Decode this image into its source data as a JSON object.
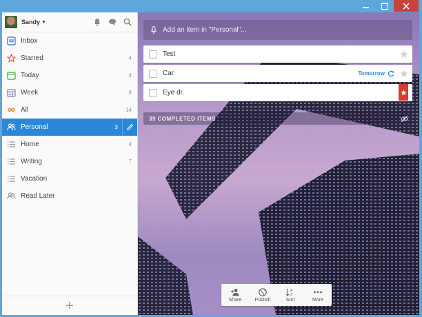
{
  "user": {
    "name": "Sandy"
  },
  "sidebar": {
    "items": [
      {
        "label": "Inbox",
        "count": "",
        "icon": "inbox-icon",
        "color": "#3a86d4"
      },
      {
        "label": "Starred",
        "count": "4",
        "icon": "star-icon",
        "color": "#e0473d"
      },
      {
        "label": "Today",
        "count": "4",
        "icon": "calendar-today-icon",
        "color": "#58b346"
      },
      {
        "label": "Week",
        "count": "8",
        "icon": "calendar-week-icon",
        "color": "#8a7fc6"
      },
      {
        "label": "All",
        "count": "14",
        "icon": "infinity-icon",
        "color": "#e78b3c"
      },
      {
        "label": "Personal",
        "count": "3",
        "icon": "people-icon",
        "color": "#ffffff"
      },
      {
        "label": "Home",
        "count": "4",
        "icon": "list-icon",
        "color": "#9a9a9a"
      },
      {
        "label": "Writing",
        "count": "7",
        "icon": "list-icon",
        "color": "#9a9a9a"
      },
      {
        "label": "Vacation",
        "count": "",
        "icon": "list-icon",
        "color": "#9a9a9a"
      },
      {
        "label": "Read Later",
        "count": "",
        "icon": "people-icon",
        "color": "#9a9a9a"
      }
    ],
    "add_label": "+"
  },
  "main": {
    "add_placeholder": "Add an item in \"Personal\"...",
    "tasks": [
      {
        "title": "Test",
        "due": "",
        "starred": false
      },
      {
        "title": "Car",
        "due": "Tomorrow",
        "starred": false
      },
      {
        "title": "Eye dr.",
        "due": "",
        "starred": true
      }
    ],
    "completed_label": "39 COMPLETED ITEMS",
    "toolbar": {
      "share": "Share",
      "publish": "Publish",
      "sort": "Sort",
      "more": "More"
    }
  },
  "colors": {
    "accent": "#2b88d9",
    "flag": "#d93c2f",
    "window": "#5fa6dc"
  }
}
